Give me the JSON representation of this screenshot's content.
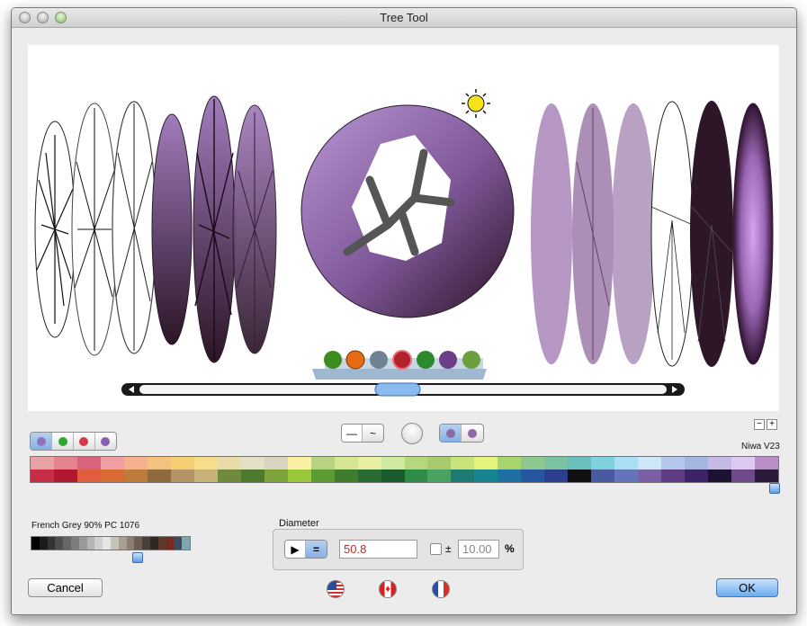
{
  "window": {
    "title": "Tree Tool"
  },
  "controls": {
    "minus": "−",
    "plus": "+"
  },
  "palette": {
    "name": "Niwa V23",
    "top_colors": [
      "#e7a2a6",
      "#e4838d",
      "#d9627c",
      "#ef9fa3",
      "#f4b08f",
      "#f4c17f",
      "#f4cf74",
      "#f6dd8c",
      "#eadbaa",
      "#e4e0c5",
      "#d8d4c0",
      "#fbf0a4",
      "#b8d284",
      "#d5e690",
      "#e7f0a0",
      "#cfe8a2",
      "#b5d87c",
      "#a9cb6d",
      "#c7e37a",
      "#e4f37c",
      "#a8d46e",
      "#8ec88e",
      "#7bc4a2",
      "#6bbfbd",
      "#7fd2dc",
      "#a9dff1",
      "#cde7f6",
      "#b6c7ec",
      "#a4b5e0",
      "#c5b9e6",
      "#dccaf0",
      "#b98ec9"
    ],
    "bottom_colors": [
      "#c72d45",
      "#b3162f",
      "#e05d3e",
      "#d86a33",
      "#c07a3a",
      "#8f6a3f",
      "#b49464",
      "#c9b27a",
      "#6f8a3b",
      "#4f7a2d",
      "#7ea33b",
      "#9bc73b",
      "#5c9b32",
      "#3e7d2d",
      "#2a6b34",
      "#1a5c2e",
      "#2e8c47",
      "#49a262",
      "#1e7b73",
      "#178590",
      "#1f6fa4",
      "#2457a0",
      "#2b3f8e",
      "#111111",
      "#4a5aa0",
      "#6374b8",
      "#7a5fa4",
      "#5e3c86",
      "#3b2365",
      "#1e1233",
      "#6e4a8a",
      "#2a1a38"
    ]
  },
  "grey_palette": {
    "selected_label": "French Grey 90% PC 1076",
    "colors": [
      "#000000",
      "#1a1a1a",
      "#333333",
      "#4d4d4d",
      "#666666",
      "#7d7d7d",
      "#9a9a9a",
      "#b4b4b4",
      "#d0d0d0",
      "#e6e6e6",
      "#c7c2b8",
      "#a89f92",
      "#8c7f6f",
      "#6b5d4f",
      "#4a3f36",
      "#2e2823",
      "#5d3b2a",
      "#7a2a1c",
      "#3b4a5e",
      "#7fa6b1"
    ]
  },
  "diameter": {
    "label": "Diameter",
    "value": "50.8",
    "plus_minus": "±",
    "variance": "10.00",
    "percent": "%"
  },
  "buttons": {
    "cancel": "Cancel",
    "ok": "OK"
  },
  "colors": {
    "accent": "#6cadef",
    "tree_primary": "#8a63a8"
  }
}
